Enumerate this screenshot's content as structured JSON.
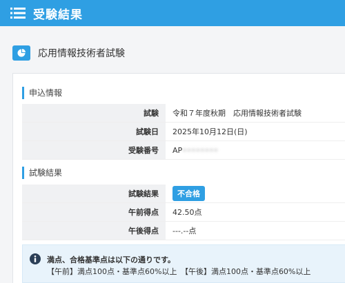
{
  "header": {
    "title": "受験結果",
    "icon": "list-menu-icon",
    "color": "#2f9fe3"
  },
  "section": {
    "title": "応用情報技術者試験",
    "icon": "pie-chart-icon"
  },
  "application": {
    "heading": "申込情報",
    "rows": [
      {
        "label": "試験",
        "value": "令和７年度秋期　応用情報技術者試験"
      },
      {
        "label": "試験日",
        "value": "2025年10月12日(日)"
      },
      {
        "label": "受験番号",
        "value": "AP"
      }
    ]
  },
  "results": {
    "heading": "試験結果",
    "rows": [
      {
        "label": "試験結果",
        "value": "不合格"
      },
      {
        "label": "午前得点",
        "value": "42.50点"
      },
      {
        "label": "午後得点",
        "value": "---.--点"
      }
    ]
  },
  "notice": {
    "title": "満点、合格基準点は以下の通りです。",
    "detail": "【午前】満点100点・基準点60%以上　【午後】満点100点・基準点60%以上"
  }
}
